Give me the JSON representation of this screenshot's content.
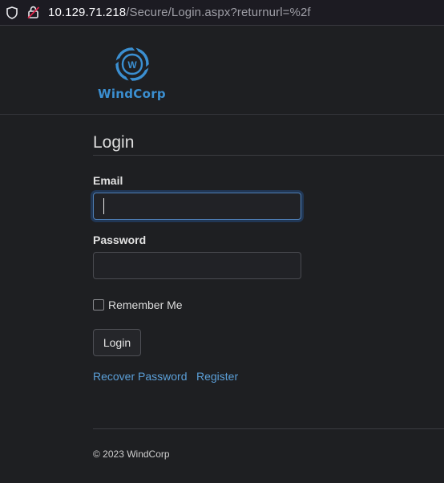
{
  "browser": {
    "url_host": "10.129.71.218",
    "url_path": "/Secure/Login.aspx?returnurl=%2f"
  },
  "header": {
    "logo_text": "WindCorp",
    "logo_letter": "W"
  },
  "form": {
    "title": "Login",
    "email_label": "Email",
    "email_value": "",
    "password_label": "Password",
    "password_value": "",
    "remember_label": "Remember Me",
    "remember_checked": false,
    "submit_label": "Login"
  },
  "links": {
    "recover": "Recover Password",
    "register": "Register"
  },
  "footer": {
    "text": "© 2023 WindCorp"
  },
  "colors": {
    "background": "#1e1f22",
    "accent": "#3b8fd1",
    "link": "#5b9fd8"
  }
}
